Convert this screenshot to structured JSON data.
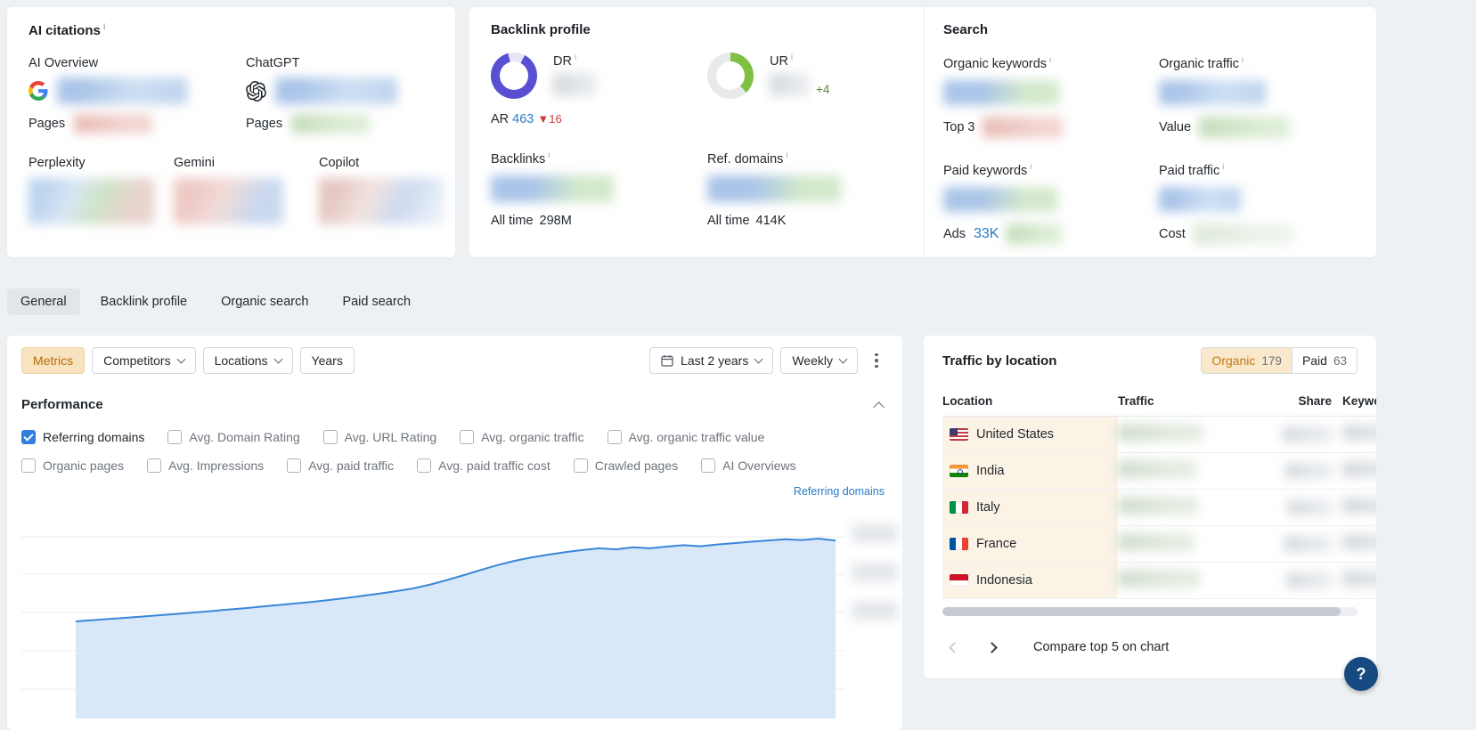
{
  "icons": {
    "info": "i",
    "help": "?"
  },
  "colors": {
    "accent_orange": "#b36d06",
    "link_blue": "#2a7cc9",
    "negative_red": "#ce3c34",
    "positive_green": "#588a33",
    "dr_ring": "#584fd1",
    "ur_ring": "#7fc143",
    "chart_line": "#3a86d8",
    "chart_fill": "#d4e6f8"
  },
  "ai": {
    "title": "AI citations",
    "ai_overview": "AI Overview",
    "chatgpt": "ChatGPT",
    "pages1": "Pages",
    "pages2": "Pages",
    "perplexity": "Perplexity",
    "gemini": "Gemini",
    "copilot": "Copilot"
  },
  "backlinks": {
    "title": "Backlink profile",
    "dr": "DR",
    "ar": "AR",
    "ar_value": "463",
    "ar_delta": "▼16",
    "ur": "UR",
    "ur_delta": "+4",
    "backlinks_label": "Backlinks",
    "all_time": "All time",
    "backlinks_total": "298M",
    "ref_domains_label": "Ref. domains",
    "all_time2": "All time",
    "ref_domains_total": "414K"
  },
  "search": {
    "title": "Search",
    "organic_keywords": "Organic keywords",
    "top3": "Top 3",
    "organic_traffic": "Organic traffic",
    "value": "Value",
    "paid_keywords": "Paid keywords",
    "ads": "Ads",
    "ads_value": "33K",
    "paid_traffic": "Paid traffic",
    "cost": "Cost"
  },
  "tabs": [
    {
      "label": "General",
      "active": true
    },
    {
      "label": "Backlink profile",
      "active": false
    },
    {
      "label": "Organic search",
      "active": false
    },
    {
      "label": "Paid search",
      "active": false
    }
  ],
  "toolbar": {
    "metrics": "Metrics",
    "competitors": "Competitors",
    "locations": "Locations",
    "years": "Years",
    "date_range": "Last 2 years",
    "granularity": "Weekly"
  },
  "performance": {
    "title": "Performance",
    "checkboxes_row1": [
      {
        "label": "Referring domains",
        "checked": true
      },
      {
        "label": "Avg. Domain Rating",
        "checked": false
      },
      {
        "label": "Avg. URL Rating",
        "checked": false
      },
      {
        "label": "Avg. organic traffic",
        "checked": false
      },
      {
        "label": "Avg. organic traffic value",
        "checked": false
      }
    ],
    "checkboxes_row2": [
      {
        "label": "Organic pages",
        "checked": false
      },
      {
        "label": "Avg. Impressions",
        "checked": false
      },
      {
        "label": "Avg. paid traffic",
        "checked": false
      },
      {
        "label": "Avg. paid traffic cost",
        "checked": false
      },
      {
        "label": "Crawled pages",
        "checked": false
      },
      {
        "label": "AI Overviews",
        "checked": false
      }
    ],
    "series_link": "Referring domains"
  },
  "traffic_by_location": {
    "title": "Traffic by location",
    "organic_toggle": {
      "label": "Organic",
      "count": "179"
    },
    "paid_toggle": {
      "label": "Paid",
      "count": "63"
    },
    "columns": {
      "location": "Location",
      "traffic": "Traffic",
      "share": "Share",
      "keywords": "Keywords"
    },
    "rows": [
      {
        "country": "United States"
      },
      {
        "country": "India"
      },
      {
        "country": "Italy"
      },
      {
        "country": "France"
      },
      {
        "country": "Indonesia"
      }
    ],
    "compare_link": "Compare top 5 on chart"
  },
  "help_button": "?",
  "chart_data": {
    "type": "area",
    "title": "Performance",
    "metric": "Referring domains",
    "x_range": "Last 2 years",
    "x_granularity": "Weekly",
    "axis_tick_labels_visible": false,
    "grid": true,
    "legend_position": "none",
    "line_color": "#3a86d8",
    "fill_color": "#d4e6f8",
    "series": [
      {
        "name": "Referring domains",
        "values_unit": "relative index (axis labels blurred in screenshot)",
        "values": [
          100,
          100.7,
          101.4,
          102.1,
          102.8,
          103.6,
          104.3,
          105.1,
          105.9,
          106.8,
          107.6,
          108.5,
          109.4,
          110.3,
          111.2,
          112.3,
          113.4,
          114.7,
          116,
          117.4,
          119,
          121.2,
          123.8,
          126.6,
          129.6,
          132.4,
          134.8,
          136.8,
          138.4,
          139.8,
          141,
          142,
          141.4,
          142.6,
          142,
          143,
          143.8,
          143.2,
          144.2,
          145,
          145.8,
          146.5,
          147.2,
          146.8,
          147.6,
          146.4
        ]
      }
    ]
  }
}
